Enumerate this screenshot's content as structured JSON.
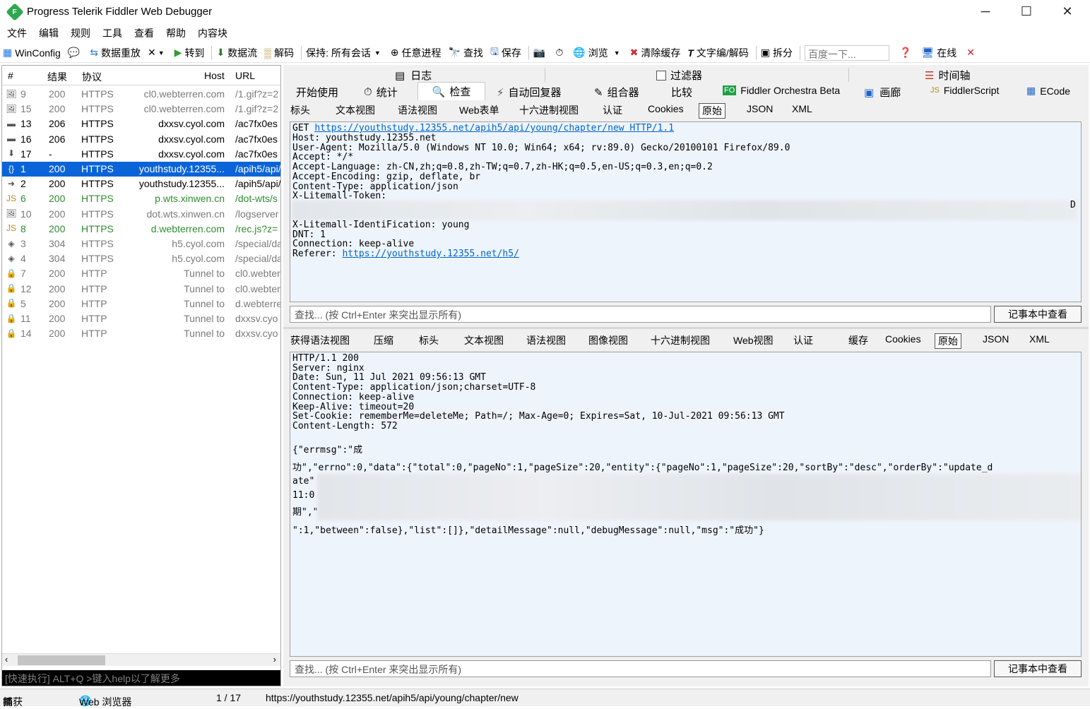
{
  "window": {
    "title": "Progress Telerik Fiddler Web Debugger",
    "minimize": "─",
    "maximize": "☐",
    "close": "✕"
  },
  "menu": [
    "文件",
    "编辑",
    "规则",
    "工具",
    "查看",
    "帮助",
    "内容块"
  ],
  "toolbar": {
    "winconfig": "WinConfig",
    "replay": "数据重放",
    "remove": "✕",
    "goto": "转到",
    "stream": "数据流",
    "decode": "解码",
    "keep": "保持: 所有会话",
    "any_process": "任意进程",
    "find": "查找",
    "save": "保存",
    "browse": "浏览",
    "clear_cache": "清除缓存",
    "text_wizard": "文字编/解码",
    "tearoff": "拆分",
    "search_placeholder": "百度一下...",
    "online": "在线"
  },
  "sessions": {
    "columns": [
      "#",
      "结果",
      "协议",
      "Host",
      "URL"
    ],
    "rows": [
      {
        "id": "9",
        "result": "200",
        "protocol": "HTTPS",
        "host": "cl0.webterren.com",
        "url": "/1.gif?z=2",
        "style": "normal",
        "icon": "image-icon",
        "glyph": "🖼"
      },
      {
        "id": "15",
        "result": "200",
        "protocol": "HTTPS",
        "host": "cl0.webterren.com",
        "url": "/1.gif?z=2",
        "style": "normal",
        "icon": "image-icon",
        "glyph": "🖼"
      },
      {
        "id": "13",
        "result": "206",
        "protocol": "HTTPS",
        "host": "dxxsv.cyol.com",
        "url": "/ac7fx0es",
        "style": "dark",
        "icon": "partial-content-icon",
        "glyph": "▬"
      },
      {
        "id": "16",
        "result": "206",
        "protocol": "HTTPS",
        "host": "dxxsv.cyol.com",
        "url": "/ac7fx0es",
        "style": "dark",
        "icon": "partial-content-icon",
        "glyph": "▬"
      },
      {
        "id": "17",
        "result": "-",
        "protocol": "HTTPS",
        "host": "dxxsv.cyol.com",
        "url": "/ac7fx0es",
        "style": "dark",
        "icon": "download-arrow-icon",
        "glyph": "⬇"
      },
      {
        "id": "1",
        "result": "200",
        "protocol": "HTTPS",
        "host": "youthstudy.12355...",
        "url": "/apih5/api/",
        "style": "selected",
        "icon": "json-icon",
        "glyph": "{}"
      },
      {
        "id": "2",
        "result": "200",
        "protocol": "HTTPS",
        "host": "youthstudy.12355...",
        "url": "/apih5/api/",
        "style": "dark",
        "icon": "redirect-icon",
        "glyph": "➜"
      },
      {
        "id": "6",
        "result": "200",
        "protocol": "HTTPS",
        "host": "p.wts.xinwen.cn",
        "url": "/dot-wts/s",
        "style": "green",
        "icon": "script-icon",
        "glyph": "JS"
      },
      {
        "id": "10",
        "result": "200",
        "protocol": "HTTPS",
        "host": "dot.wts.xinwen.cn",
        "url": "/logserver",
        "style": "gray",
        "icon": "image-icon",
        "glyph": "🖼"
      },
      {
        "id": "8",
        "result": "200",
        "protocol": "HTTPS",
        "host": "d.webterren.com",
        "url": "/rec.js?z=",
        "style": "green",
        "icon": "script-icon",
        "glyph": "JS"
      },
      {
        "id": "3",
        "result": "304",
        "protocol": "HTTPS",
        "host": "h5.cyol.com",
        "url": "/special/da",
        "style": "gray",
        "icon": "not-modified-icon",
        "glyph": "◈"
      },
      {
        "id": "4",
        "result": "304",
        "protocol": "HTTPS",
        "host": "h5.cyol.com",
        "url": "/special/da",
        "style": "gray",
        "icon": "not-modified-icon",
        "glyph": "◈"
      },
      {
        "id": "7",
        "result": "200",
        "protocol": "HTTP",
        "host": "Tunnel to",
        "url": "cl0.webter",
        "style": "gray",
        "icon": "lock-icon",
        "glyph": "🔒"
      },
      {
        "id": "12",
        "result": "200",
        "protocol": "HTTP",
        "host": "Tunnel to",
        "url": "cl0.webter",
        "style": "gray",
        "icon": "lock-icon",
        "glyph": "🔒"
      },
      {
        "id": "5",
        "result": "200",
        "protocol": "HTTP",
        "host": "Tunnel to",
        "url": "d.webterre",
        "style": "gray",
        "icon": "lock-icon",
        "glyph": "🔒"
      },
      {
        "id": "11",
        "result": "200",
        "protocol": "HTTP",
        "host": "Tunnel to",
        "url": "dxxsv.cyo",
        "style": "gray",
        "icon": "lock-icon",
        "glyph": "🔒"
      },
      {
        "id": "14",
        "result": "200",
        "protocol": "HTTP",
        "host": "Tunnel to",
        "url": "dxxsv.cyo",
        "style": "gray",
        "icon": "lock-icon",
        "glyph": "🔒"
      }
    ],
    "quickexec_placeholder": "[快速执行] ALT+Q >键入help以了解更多"
  },
  "tabs": {
    "top": [
      "日志",
      "过滤器",
      "时间轴"
    ],
    "main": [
      "开始使用",
      "统计",
      "检查",
      "自动回复器",
      "组合器",
      "比较",
      "Fiddler Orchestra Beta",
      "画廊",
      "FiddlerScript",
      "ECode"
    ],
    "fo_badge": "FO",
    "active_main": "检查",
    "request_sub": [
      "标头",
      "文本视图",
      "语法视图",
      "Web表单",
      "十六进制视图",
      "认证",
      "Cookies",
      "原始",
      "JSON",
      "XML"
    ],
    "response_sub": [
      "获得语法视图",
      "压缩",
      "标头",
      "文本视图",
      "语法视图",
      "图像视图",
      "十六进制视图",
      "Web视图",
      "认证",
      "缓存",
      "Cookies",
      "原始",
      "JSON",
      "XML"
    ]
  },
  "request": {
    "method": "GET ",
    "url": "https://youthstudy.12355.net/apih5/api/young/chapter/new HTTP/1.1",
    "lines": [
      "Host: youthstudy.12355.net",
      "User-Agent: Mozilla/5.0 (Windows NT 10.0; Win64; x64; rv:89.0) Gecko/20100101 Firefox/89.0",
      "Accept: */*",
      "Accept-Language: zh-CN,zh;q=0.8,zh-TW;q=0.7,zh-HK;q=0.5,en-US;q=0.3,en;q=0.2",
      "Accept-Encoding: gzip, deflate, br",
      "Content-Type: application/json",
      "X-Litemall-Token:"
    ],
    "token_tail": "D",
    "lines2": [
      "X-Litemall-IdentiFication: young",
      "DNT: 1",
      "Connection: keep-alive"
    ],
    "referer_label": "Referer: ",
    "referer_url": "https://youthstudy.12355.net/h5/"
  },
  "response": {
    "lines": [
      "HTTP/1.1 200",
      "Server: nginx",
      "Date: Sun, 11 Jul 2021 09:56:13 GMT",
      "Content-Type: application/json;charset=UTF-8",
      "Connection: keep-alive",
      "Keep-Alive: timeout=20",
      "Set-Cookie: rememberMe=deleteMe; Path=/; Max-Age=0; Expires=Sat, 10-Jul-2021 09:56:13 GMT",
      "Content-Length: 572"
    ],
    "body1": "{\"errmsg\":\"成",
    "body2": "功\",\"errno\":0,\"data\":{\"total\":0,\"pageNo\":1,\"pageSize\":20,\"entity\":{\"pageNo\":1,\"pageSize\":20,\"sortBy\":\"desc\",\"orderBy\":\"update_d",
    "body3": "ate\"",
    "body4": "11:0",
    "body5": "期\",\"",
    "body6": "\":1,\"between\":false},\"list\":[]},\"detailMessage\":null,\"debugMessage\":null,\"msg\":\"成功\"}"
  },
  "find": {
    "placeholder": "查找... (按 Ctrl+Enter 来突出显示所有)",
    "button": "记事本中查看"
  },
  "status": {
    "capture": "捕获",
    "browser": "Web 浏览器",
    "count": "1 / 17",
    "url": "https://youthstudy.12355.net/apih5/api/young/chapter/new"
  }
}
